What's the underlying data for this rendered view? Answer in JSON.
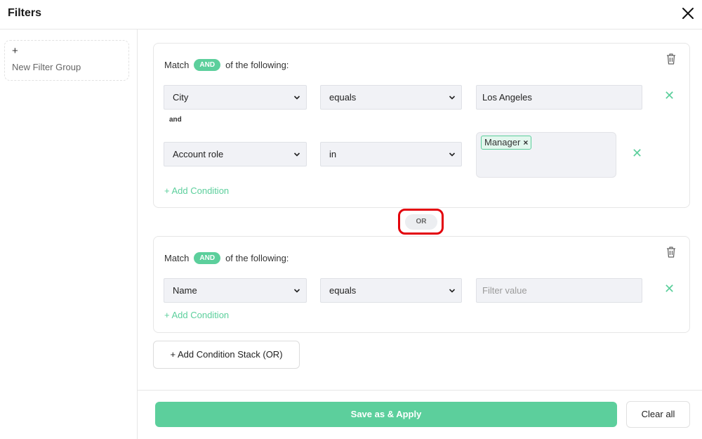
{
  "header": {
    "title": "Filters",
    "close_icon": "close-icon"
  },
  "sidebar": {
    "new_group_plus": "+",
    "new_group_label": "New Filter Group"
  },
  "groups": [
    {
      "match_prefix": "Match",
      "operator": "AND",
      "match_suffix": "of the following:",
      "conditions": [
        {
          "field": "City",
          "op": "equals",
          "value": "Los Angeles"
        },
        {
          "joiner": "and"
        },
        {
          "field": "Account role",
          "op": "in",
          "values": [
            "Manager"
          ]
        }
      ],
      "add_condition": "+ Add Condition"
    },
    {
      "match_prefix": "Match",
      "operator": "AND",
      "match_suffix": "of the following:",
      "conditions": [
        {
          "field": "Name",
          "op": "equals",
          "value": "",
          "placeholder": "Filter value"
        }
      ],
      "add_condition": "+ Add Condition"
    }
  ],
  "or_label": "OR",
  "remove_chip_glyph": "×",
  "remove_condition_glyph": "✕",
  "add_stack": "+ Add Condition Stack (OR)",
  "footer": {
    "save_label": "Save as & Apply",
    "clear_label": "Clear all"
  },
  "colors": {
    "accent": "#5ccf9c",
    "highlight": "#e3000b"
  }
}
